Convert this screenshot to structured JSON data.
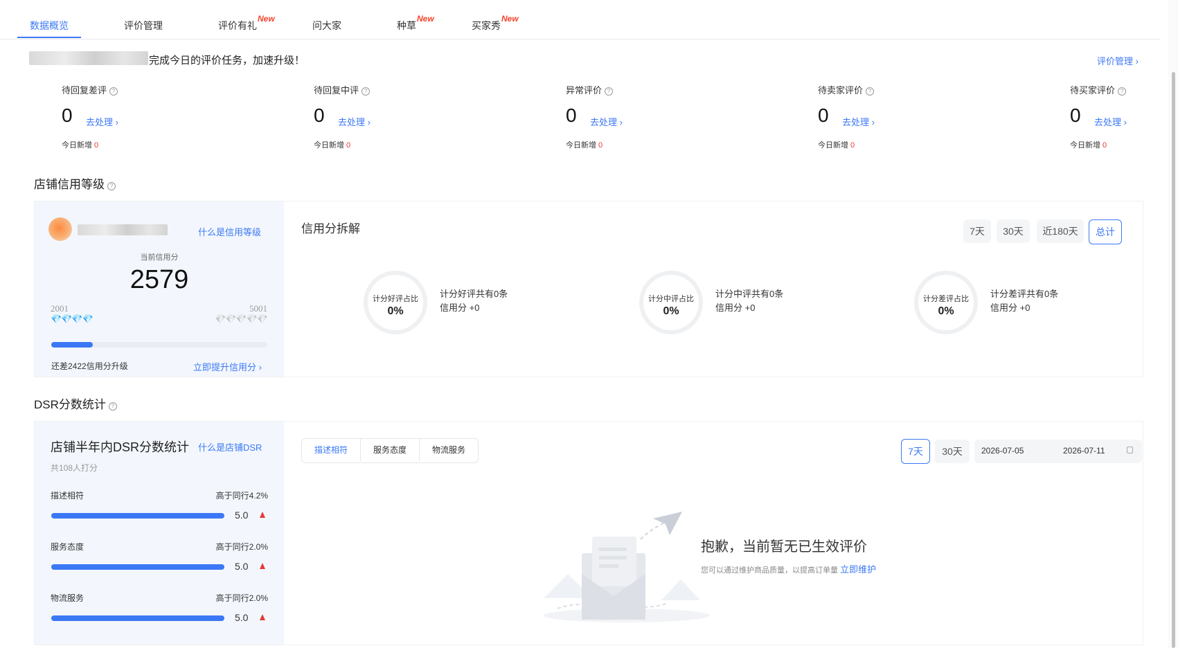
{
  "tabs": [
    {
      "label": "数据概览",
      "active": true,
      "new": ""
    },
    {
      "label": "评价管理",
      "active": false,
      "new": ""
    },
    {
      "label": "评价有礼",
      "active": false,
      "new": "New"
    },
    {
      "label": "问大家",
      "active": false,
      "new": ""
    },
    {
      "label": "种草",
      "active": false,
      "new": "New"
    },
    {
      "label": "买家秀",
      "active": false,
      "new": "New"
    }
  ],
  "notice": {
    "text": "完成今日的评价任务，加速升级！",
    "manage_link": "评价管理 ›"
  },
  "stats": [
    {
      "label": "待回复差评",
      "value": "0",
      "action": "去处理 ›",
      "today_label": "今日新增",
      "today_value": "0"
    },
    {
      "label": "待回复中评",
      "value": "0",
      "action": "去处理 ›",
      "today_label": "今日新增",
      "today_value": "0"
    },
    {
      "label": "异常评价",
      "value": "0",
      "action": "去处理 ›",
      "today_label": "今日新增",
      "today_value": "0"
    },
    {
      "label": "待卖家评价",
      "value": "0",
      "action": "去处理 ›",
      "today_label": "今日新增",
      "today_value": "0"
    },
    {
      "label": "待买家评价",
      "value": "0",
      "action": "去处理 ›",
      "today_label": "今日新增",
      "today_value": "0"
    }
  ],
  "credit": {
    "section_title": "店铺信用等级",
    "what_link": "什么是信用等级",
    "current_label": "当前信用分",
    "current_score": "2579",
    "min": "2001",
    "max": "5001",
    "progress": 0.193,
    "remaining_text": "还差2422信用分升级",
    "boost_link": "立即提升信用分 ›",
    "breakdown_title": "信用分拆解",
    "periods": [
      {
        "label": "7天",
        "active": false
      },
      {
        "label": "30天",
        "active": false
      },
      {
        "label": "近180天",
        "active": false
      },
      {
        "label": "总计",
        "active": true
      }
    ],
    "rings": [
      {
        "label": "计分好评占比",
        "value": "0%",
        "line1": "计分好评共有0条",
        "line2": "信用分 +0"
      },
      {
        "label": "计分中评占比",
        "value": "0%",
        "line1": "计分中评共有0条",
        "line2": "信用分 +0"
      },
      {
        "label": "计分差评占比",
        "value": "0%",
        "line1": "计分差评共有0条",
        "line2": "信用分 +0"
      }
    ]
  },
  "dsr": {
    "section_title": "DSR分数统计",
    "card_title": "店铺半年内DSR分数统计",
    "what_link": "什么是店铺DSR",
    "count_text": "共108人打分",
    "items": [
      {
        "name": "描述相符",
        "compare": "高于同行4.2%",
        "score": "5.0",
        "fill": 1.0
      },
      {
        "name": "服务态度",
        "compare": "高于同行2.0%",
        "score": "5.0",
        "fill": 1.0
      },
      {
        "name": "物流服务",
        "compare": "高于同行2.0%",
        "score": "5.0",
        "fill": 1.0
      }
    ],
    "tabs": [
      {
        "label": "描述相符",
        "active": true
      },
      {
        "label": "服务态度",
        "active": false
      },
      {
        "label": "物流服务",
        "active": false
      }
    ],
    "periods": [
      {
        "label": "7天",
        "active": true
      },
      {
        "label": "30天",
        "active": false
      }
    ],
    "date_start": "2026-07-05",
    "date_end": "2026-07-11",
    "empty_title": "抱歉，当前暂无已生效评价",
    "empty_desc": "您可以通过维护商品质量，以提高订单量",
    "empty_link": "立即维护"
  },
  "colors": {
    "accent": "#3b78f5",
    "new_badge": "#f5432c",
    "up_arrow": "#e53935",
    "card_bg": "#f3f7fd"
  }
}
